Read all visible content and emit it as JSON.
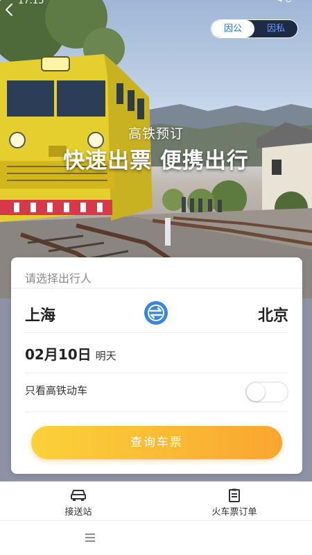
{
  "status_bar": {
    "time": "17:15",
    "network_label": "4G"
  },
  "header": {
    "mode_tabs": [
      {
        "label": "因公",
        "active": true
      },
      {
        "label": "因私",
        "active": false
      }
    ],
    "subtitle": "高铁预订",
    "title": "快速出票 便携出行"
  },
  "booking": {
    "passenger_placeholder": "请选择出行人",
    "from_city": "上海",
    "to_city": "北京",
    "date": "02月10日",
    "date_tag": "明天",
    "filter_label": "只看高铁动车",
    "filter_on": false,
    "search_label": "查询车票"
  },
  "bottom_nav": {
    "items": [
      {
        "label": "接送站",
        "icon": "car-icon"
      },
      {
        "label": "火车票订单",
        "icon": "order-list-icon"
      }
    ]
  },
  "colors": {
    "accent_blue": "#2b6fd8",
    "button_gradient_start": "#fbd23a",
    "button_gradient_end": "#f9a62f",
    "toggle_dark": "#1f2b46"
  }
}
